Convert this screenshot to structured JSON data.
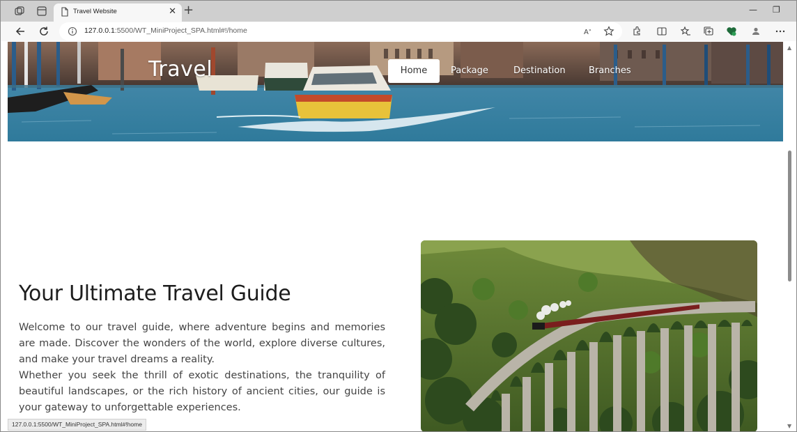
{
  "browser": {
    "tab": {
      "title": "Travel Website",
      "icon": "page-icon",
      "close_glyph": "✕"
    },
    "new_tab_glyph": "+",
    "address": {
      "host": "127.0.0.1",
      "path": ":5500/WT_MiniProject_SPA.html#!/home"
    },
    "status_url": "127.0.0.1:5500/WT_MiniProject_SPA.html#!home",
    "window_controls": {
      "minimize": "—",
      "restore": "❐"
    },
    "accent": "#1a73e8"
  },
  "site": {
    "title": "Travel",
    "nav": [
      {
        "label": "Home",
        "active": true
      },
      {
        "label": "Package",
        "active": false
      },
      {
        "label": "Destination",
        "active": false
      },
      {
        "label": "Branches",
        "active": false
      }
    ]
  },
  "content": {
    "heading": "Your Ultimate Travel Guide",
    "paragraph_1": "Welcome to our travel guide, where adventure begins and memories are made. Discover the wonders of the world, explore diverse cultures, and make your travel dreams a reality.",
    "paragraph_2": "Whether you seek the thrill of exotic destinations, the tranquility of beautiful landscapes, or the rich history of ancient cities, our guide is your gateway to unforgettable experiences."
  }
}
